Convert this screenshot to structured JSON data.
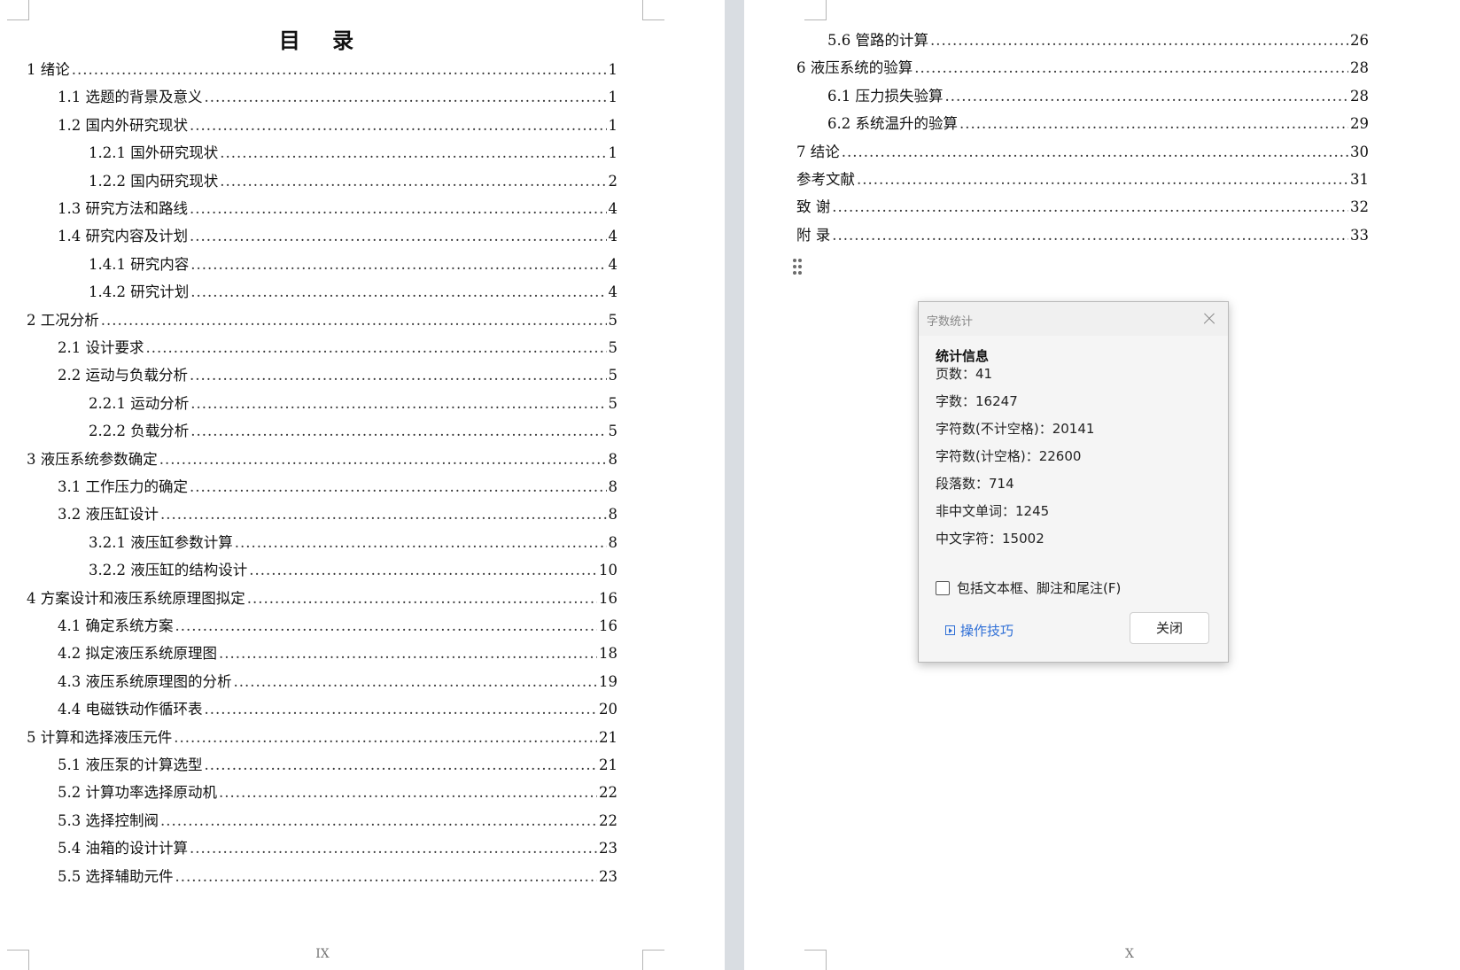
{
  "left_page": {
    "title": "目 录",
    "page_number": "IX",
    "entries": [
      {
        "label": "1 绪论",
        "page": "1",
        "level": 0
      },
      {
        "label": "1.1 选题的背景及意义",
        "page": "1",
        "level": 1
      },
      {
        "label": "1.2 国内外研究现状",
        "page": "1",
        "level": 1
      },
      {
        "label": "1.2.1 国外研究现状",
        "page": "1",
        "level": 2
      },
      {
        "label": "1.2.2 国内研究现状",
        "page": "2",
        "level": 2
      },
      {
        "label": "1.3 研究方法和路线",
        "page": "4",
        "level": 1
      },
      {
        "label": "1.4 研究内容及计划",
        "page": "4",
        "level": 1
      },
      {
        "label": "1.4.1 研究内容",
        "page": "4",
        "level": 2
      },
      {
        "label": "1.4.2 研究计划",
        "page": "4",
        "level": 2
      },
      {
        "label": "2 工况分析",
        "page": "5",
        "level": 0
      },
      {
        "label": "2.1 设计要求",
        "page": "5",
        "level": 1
      },
      {
        "label": "2.2 运动与负载分析",
        "page": "5",
        "level": 1
      },
      {
        "label": "2.2.1 运动分析",
        "page": "5",
        "level": 2
      },
      {
        "label": "2.2.2 负载分析",
        "page": "5",
        "level": 2
      },
      {
        "label": "3 液压系统参数确定",
        "page": "8",
        "level": 0
      },
      {
        "label": "3.1 工作压力的确定",
        "page": "8",
        "level": 1
      },
      {
        "label": "3.2 液压缸设计",
        "page": "8",
        "level": 1
      },
      {
        "label": "3.2.1 液压缸参数计算",
        "page": "8",
        "level": 2
      },
      {
        "label": "3.2.2 液压缸的结构设计",
        "page": "10",
        "level": 2
      },
      {
        "label": "4 方案设计和液压系统原理图拟定",
        "page": "16",
        "level": 0
      },
      {
        "label": "4.1 确定系统方案",
        "page": "16",
        "level": 1
      },
      {
        "label": "4.2 拟定液压系统原理图",
        "page": "18",
        "level": 1
      },
      {
        "label": "4.3 液压系统原理图的分析",
        "page": "19",
        "level": 1
      },
      {
        "label": "4.4 电磁铁动作循环表",
        "page": "20",
        "level": 1
      },
      {
        "label": "5 计算和选择液压元件",
        "page": "21",
        "level": 0
      },
      {
        "label": "5.1 液压泵的计算选型",
        "page": "21",
        "level": 1
      },
      {
        "label": "5.2 计算功率选择原动机",
        "page": "22",
        "level": 1
      },
      {
        "label": "5.3 选择控制阀",
        "page": "22",
        "level": 1
      },
      {
        "label": "5.4 油箱的设计计算",
        "page": "23",
        "level": 1
      },
      {
        "label": "5.5 选择辅助元件",
        "page": "23",
        "level": 1
      }
    ]
  },
  "right_page": {
    "page_number": "X",
    "entries": [
      {
        "label": "5.6 管路的计算",
        "page": "26",
        "level": 1
      },
      {
        "label": "6 液压系统的验算",
        "page": "28",
        "level": 0
      },
      {
        "label": "6.1 压力损失验算",
        "page": "28",
        "level": 1
      },
      {
        "label": "6.2 系统温升的验算",
        "page": "29",
        "level": 1
      },
      {
        "label": "7 结论",
        "page": "30",
        "level": 0
      },
      {
        "label": "参考文献",
        "page": "31",
        "level": 0
      },
      {
        "label": "致 谢",
        "page": "32",
        "level": 0
      },
      {
        "label": "附 录",
        "page": "33",
        "level": 0
      }
    ]
  },
  "dialog": {
    "title": "字数统计",
    "section_title": "统计信息",
    "stats": [
      {
        "label": "页数：",
        "value": "41"
      },
      {
        "label": "字数：",
        "value": "16247"
      },
      {
        "label": "字符数(不计空格)：",
        "value": "20141"
      },
      {
        "label": "字符数(计空格)：",
        "value": "22600"
      },
      {
        "label": "段落数：",
        "value": "714"
      },
      {
        "label": "非中文单词：",
        "value": "1245"
      },
      {
        "label": "中文字符：",
        "value": "15002"
      }
    ],
    "checkbox_label": "包括文本框、脚注和尾注(F)",
    "checkbox_checked": false,
    "tips_label": "操作技巧",
    "close_label": "关闭"
  }
}
